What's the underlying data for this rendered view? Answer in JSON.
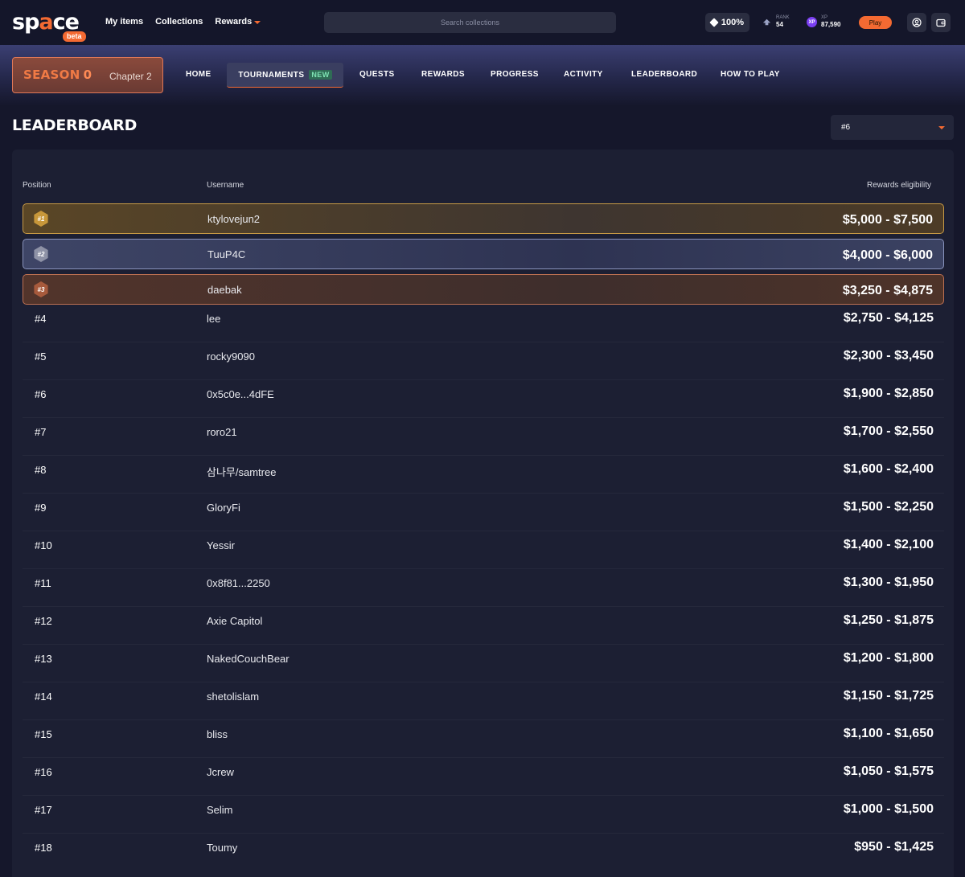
{
  "brand": {
    "logo_text": "space",
    "badge": "beta"
  },
  "topnav": [
    {
      "label": "My items"
    },
    {
      "label": "Collections"
    },
    {
      "label": "Rewards"
    }
  ],
  "search": {
    "placeholder": "Search collections"
  },
  "stats": {
    "percent": "100%",
    "rank_label": "RANK",
    "rank_value": "54",
    "xp_badge": "XP",
    "xp_label": "XP",
    "xp_value": "87,590"
  },
  "play_label": "Play",
  "season": {
    "title": "SEASON",
    "number": "0",
    "chapter": "Chapter 2"
  },
  "mainnav": [
    {
      "label": "HOME"
    },
    {
      "label": "TOURNAMENTS",
      "badge": "NEW"
    },
    {
      "label": "QUESTS"
    },
    {
      "label": "REWARDS"
    },
    {
      "label": "PROGRESS"
    },
    {
      "label": "ACTIVITY"
    },
    {
      "label": "LEADERBOARD"
    },
    {
      "label": "HOW TO PLAY"
    }
  ],
  "page_title": "LEADERBOARD",
  "filter": {
    "selected": "#6"
  },
  "table": {
    "headers": {
      "position": "Position",
      "username": "Username",
      "rewards": "Rewards eligibility"
    },
    "rows": [
      {
        "position": "#1",
        "username": "ktylovejun2",
        "rewards": "$5,000 - $7,500"
      },
      {
        "position": "#2",
        "username": "TuuP4C",
        "rewards": "$4,000 - $6,000"
      },
      {
        "position": "#3",
        "username": "daebak",
        "rewards": "$3,250 - $4,875"
      },
      {
        "position": "#4",
        "username": "lee",
        "rewards": "$2,750 - $4,125"
      },
      {
        "position": "#5",
        "username": "rocky9090",
        "rewards": "$2,300 - $3,450"
      },
      {
        "position": "#6",
        "username": "0x5c0e...4dFE",
        "rewards": "$1,900 - $2,850"
      },
      {
        "position": "#7",
        "username": "roro21",
        "rewards": "$1,700 - $2,550"
      },
      {
        "position": "#8",
        "username": "삼나무/samtree",
        "rewards": "$1,600 - $2,400"
      },
      {
        "position": "#9",
        "username": "GloryFi",
        "rewards": "$1,500 - $2,250"
      },
      {
        "position": "#10",
        "username": "Yessir",
        "rewards": "$1,400 - $2,100"
      },
      {
        "position": "#11",
        "username": "0x8f81...2250",
        "rewards": "$1,300 - $1,950"
      },
      {
        "position": "#12",
        "username": "Axie Capitol",
        "rewards": "$1,250 - $1,875"
      },
      {
        "position": "#13",
        "username": "NakedCouchBear",
        "rewards": "$1,200 - $1,800"
      },
      {
        "position": "#14",
        "username": "shetolislam",
        "rewards": "$1,150 - $1,725"
      },
      {
        "position": "#15",
        "username": "bliss",
        "rewards": "$1,100 - $1,650"
      },
      {
        "position": "#16",
        "username": "Jcrew",
        "rewards": "$1,050 - $1,575"
      },
      {
        "position": "#17",
        "username": "Selim",
        "rewards": "$1,000 - $1,500"
      },
      {
        "position": "#18",
        "username": "Toumy",
        "rewards": "$950 - $1,425"
      }
    ]
  },
  "icons": {
    "percent": "diamond-icon",
    "rank": "rank-icon",
    "xp": "xp-icon",
    "account": "user-circle-icon",
    "wallet": "wallet-icon",
    "filter": "chevron-down-icon"
  },
  "colors": {
    "accent": "#f46a32",
    "background": "#15172b",
    "panel": "#1c1f33",
    "gold": "#c79a45",
    "silver": "#8a94bd",
    "bronze": "#bd7052",
    "new_badge": "#7fe3b4"
  }
}
